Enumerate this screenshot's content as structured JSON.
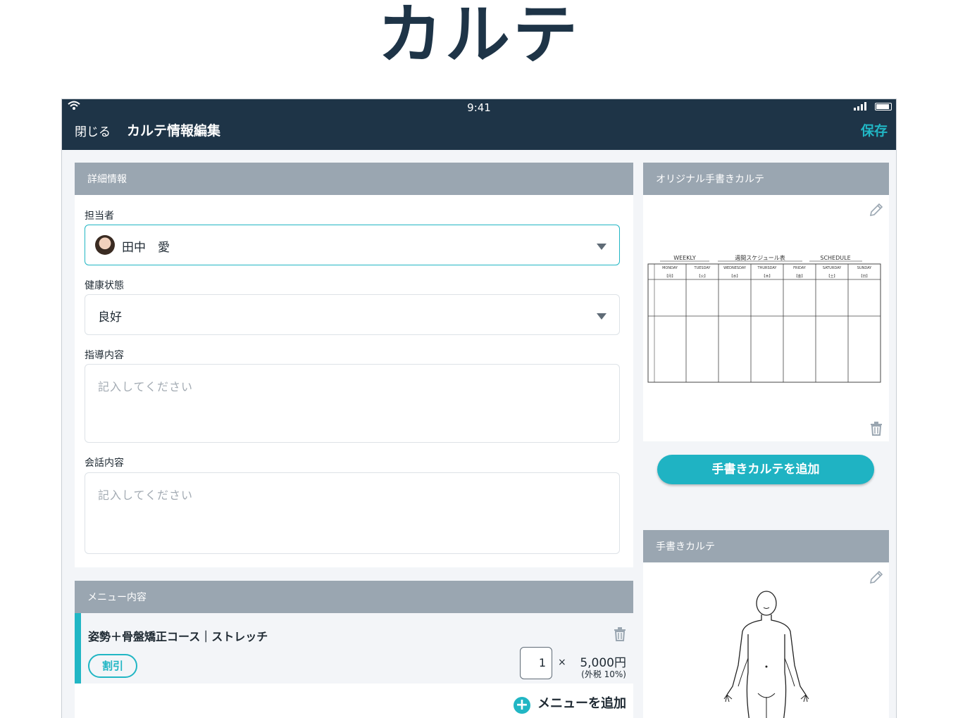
{
  "page": {
    "title": "カルテ"
  },
  "status_bar": {
    "time": "9:41"
  },
  "nav": {
    "close_label": "閉じる",
    "title": "カルテ情報編集",
    "save_label": "保存"
  },
  "details": {
    "header": "詳細情報",
    "staff": {
      "label": "担当者",
      "value": "田中　愛"
    },
    "health": {
      "label": "健康状態",
      "value": "良好"
    },
    "guidance": {
      "label": "指導内容",
      "placeholder": "記入してください"
    },
    "conversation": {
      "label": "会話内容",
      "placeholder": "記入してください"
    }
  },
  "menu": {
    "header": "メニュー内容",
    "items": [
      {
        "name": "姿勢＋骨盤矯正コース｜ストレッチ",
        "discount_label": "割引",
        "quantity": "1",
        "times": "×",
        "price": "5,000円",
        "tax": "(外税 10%)"
      }
    ],
    "add_label": "メニューを追加",
    "add_icon": "plus-circle-icon"
  },
  "original_karte": {
    "header": "オリジナル手書きカルテ",
    "sheet": {
      "headings": [
        "WEEKLY",
        "週間スケジュール表",
        "SCHEDULE"
      ],
      "days": [
        "MONDAY",
        "TUESDAY",
        "WEDNESDAY",
        "THURSDAY",
        "FRIDAY",
        "SATURDAY",
        "SUNDAY"
      ],
      "day_marks": [
        "【月】",
        "【火】",
        "【水】",
        "【木】",
        "【金】",
        "【土】",
        "【日】"
      ]
    }
  },
  "add_karte_label": "手書きカルテを追加",
  "handwritten_karte": {
    "header": "手書きカルテ"
  },
  "colors": {
    "navy": "#1e3447",
    "accent": "#21b6c4",
    "panel_header": "#9aa6b1",
    "background": "#f3f5f8"
  }
}
